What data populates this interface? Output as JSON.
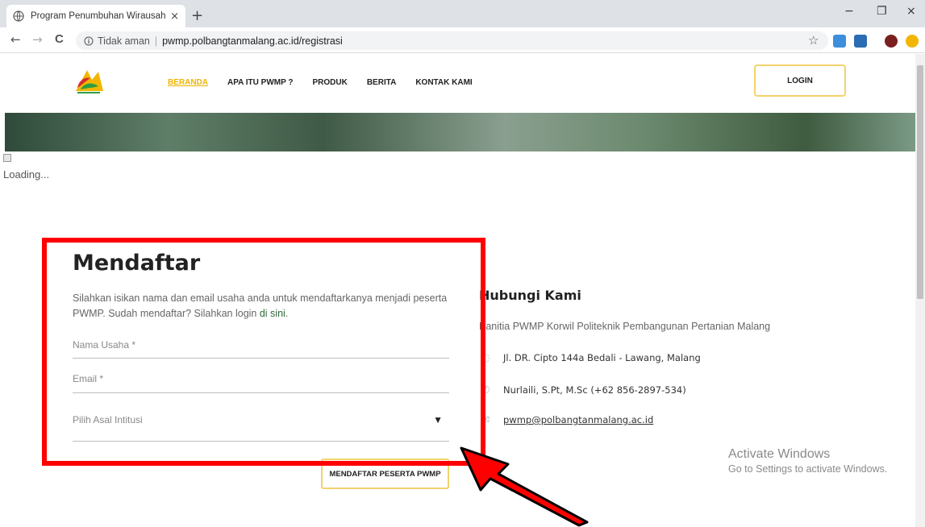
{
  "browser": {
    "tab_title": "Program Penumbuhan Wirausaha",
    "tab_close": "×",
    "new_tab": "+",
    "minimize": "−",
    "restore": "❐",
    "close": "×",
    "back": "←",
    "forward": "→",
    "reload": "C",
    "security_label": "Tidak aman",
    "url": "pwmp.polbangtanmalang.ac.id/registrasi",
    "star": "☆"
  },
  "site": {
    "nav": [
      "BERANDA",
      "APA ITU PWMP ?",
      "PRODUK",
      "BERITA",
      "KONTAK KAMI"
    ],
    "login": "LOGIN",
    "loading": "Loading..."
  },
  "form": {
    "title": "Mendaftar",
    "intro_text": "Silahkan isikan nama dan email usaha anda untuk mendaftarkanya menjadi peserta PWMP. Sudah mendaftar? Silahkan login ",
    "intro_link": "di sini",
    "intro_end": ".",
    "nama_usaha": "Nama Usaha *",
    "email": "Email *",
    "institusi": "Pilih Asal Intitusi",
    "caret": "▼",
    "submit": "MENDAFTAR PESERTA PWMP"
  },
  "contact": {
    "title": "Hubungi Kami",
    "panitia": "Panitia PWMP Korwil Politeknik Pembangunan Pertanian Malang",
    "address": "Jl. DR. Cipto 144a Bedali - Lawang, Malang",
    "person": "Nurlaili, S.Pt, M.Sc (+62 856-2897-534)",
    "email": "pwmp@polbangtanmalang.ac.id"
  },
  "watermark": {
    "line1": "Activate Windows",
    "line2": "Go to Settings to activate Windows."
  },
  "colors": {
    "accent": "#f0b400",
    "annotation": "#ff0000"
  }
}
